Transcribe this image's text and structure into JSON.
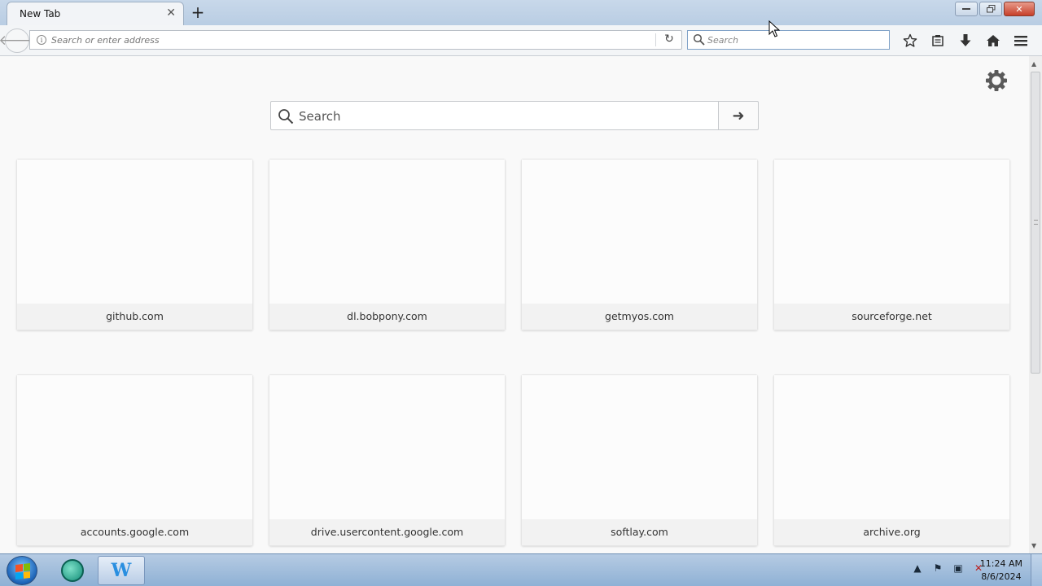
{
  "tab": {
    "title": "New Tab"
  },
  "navbar": {
    "url_placeholder": "Search or enter address",
    "search_placeholder": "Search"
  },
  "newtab": {
    "search_placeholder": "Search",
    "tiles": [
      {
        "label": "github.com"
      },
      {
        "label": "dl.bobpony.com"
      },
      {
        "label": "getmyos.com"
      },
      {
        "label": "sourceforge.net"
      },
      {
        "label": "accounts.google.com"
      },
      {
        "label": "drive.usercontent.google.com"
      },
      {
        "label": "softlay.com"
      },
      {
        "label": "archive.org"
      }
    ]
  },
  "taskbar": {
    "time": "11:24 AM",
    "date": "8/6/2024"
  },
  "icons": {
    "back": "back-arrow-icon",
    "info": "info-icon",
    "reload": "reload-icon",
    "search": "search-icon",
    "bookmark": "star-icon",
    "reading_list": "clipboard-icon",
    "downloads": "download-icon",
    "home": "home-icon",
    "menu": "hamburger-menu-icon",
    "settings": "gear-icon"
  },
  "colors": {
    "tab_strip": "#c8d8ea",
    "page_background": "#f9f9f9",
    "close_button": "#c7402a",
    "taskbar": "#a9c2e0"
  }
}
